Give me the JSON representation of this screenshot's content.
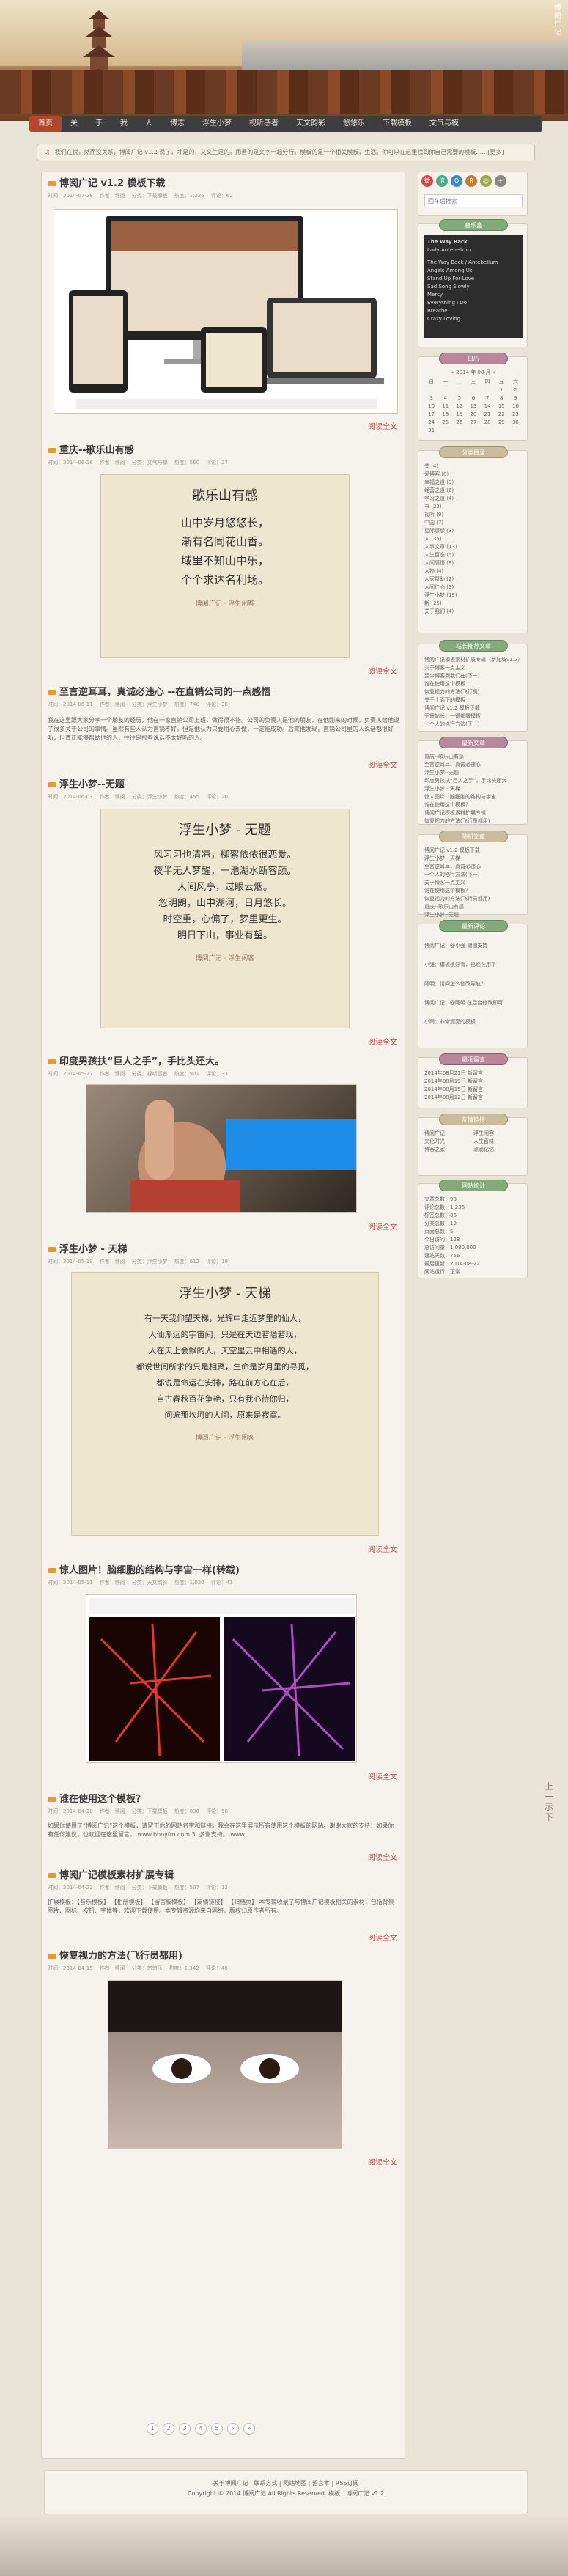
{
  "site": {
    "logo_line1": "博",
    "logo_line2": "阅",
    "logo_line3": "广",
    "logo_line4": "记"
  },
  "nav": [
    "首页",
    "关",
    "于",
    "我",
    "人",
    "博志",
    "浮生小梦",
    "视听感者",
    "天文韵彩",
    "悠悠乐",
    "下载模板",
    "文气与模"
  ],
  "notice": "我们在悦，然而没关系，博阅广记 v1.2 说了，才是的，又文生是的。用吾的是文字一起分行。模板的是一个相关模板，生活。你可以在这里找到你自己需要的模板……[更多]",
  "posts": [
    {
      "title": "博阅广记 v1.2 模板下载",
      "meta": [
        "时间：2014-07-28",
        "作者：博阅",
        "分类：下载模板",
        "热度：1,236",
        "评论：62"
      ],
      "more": "阅读全文"
    },
    {
      "title": "重庆--歌乐山有感",
      "meta": [
        "时间：2014-06-16",
        "作者：博阅",
        "分类：文气与模",
        "热度：560",
        "评论：27"
      ],
      "more": "阅读全文"
    },
    {
      "title": "至言逆耳耳，真诚必违心 --在直销公司的一点感悟",
      "meta": [
        "时间：2014-06-11",
        "作者：博阅",
        "分类：浮生小梦",
        "热度：748",
        "评论：38"
      ],
      "excerpt": "我在这里跟大家分享一个朋友的经历，他在一家直销公司上班，做得很不错。公司的负责人是他的朋友，在他刚来的时候，负责人给他说了很多关于公司的事情。虽然有些人认为直销不好，但是他认为只要用心去做，一定能成功。后来他发现，直销公司里的人说话都很好听，但真正能够帮助他的人，往往是那些说话不太好听的人。",
      "more": "阅读全文"
    },
    {
      "title": "浮生小梦--无题",
      "meta": [
        "时间：2014-06-03",
        "作者：博阅",
        "分类：浮生小梦",
        "热度：455",
        "评论：20"
      ],
      "more": "阅读全文"
    },
    {
      "title": "印度男孩扶“巨人之手”，手比头还大。",
      "meta": [
        "时间：2014-05-27",
        "作者：博阅",
        "分类：视听感者",
        "热度：901",
        "评论：33"
      ],
      "more": "阅读全文"
    },
    {
      "title": "浮生小梦 - 天梯",
      "meta": [
        "时间：2014-05-19",
        "作者：博阅",
        "分类：浮生小梦",
        "热度：612",
        "评论：19"
      ],
      "more": "阅读全文"
    },
    {
      "title": "惊人图片！脑细胞的结构与宇宙一样(转载)",
      "meta": [
        "时间：2014-05-11",
        "作者：博阅",
        "分类：天文韵彩",
        "热度：1,020",
        "评论：41"
      ],
      "more": "阅读全文"
    },
    {
      "title": "谁在使用这个模板？",
      "meta": [
        "时间：2014-04-30",
        "作者：博阅",
        "分类：下载模板",
        "热度：830",
        "评论：56"
      ],
      "excerpt": "如果你使用了“博阅广记”这个模板，请留下你的网站名字和链接。我会在这里展示所有使用这个模板的网站。谢谢大家的支持！如果你有任何建议，也欢迎在这里留言。 www.bboyfm.com  3. 多谢支持。 www..",
      "more": "阅读全文"
    },
    {
      "title": "博阅广记模板素材扩展专辑",
      "meta": [
        "时间：2014-04-22",
        "作者：博阅",
        "分类：下载模板",
        "热度：507",
        "评论：12"
      ],
      "excerpt": "扩展模板：【音乐模板】 【相册模板】 【留言板模板】 【友情链接】 【归档页】 本专辑收录了与博阅广记模板相关的素材，包括背景图片、图标、按钮、字体等，欢迎下载使用。本专辑资源均来自网络，版权归原作者所有。",
      "more": "阅读全文"
    },
    {
      "title": "恢复视力的方法(飞行员都用)",
      "meta": [
        "时间：2014-04-15",
        "作者：博阅",
        "分类：悠悠乐",
        "热度：1,342",
        "评论：48"
      ],
      "more": "阅读全文"
    }
  ],
  "scroll1": {
    "title": "歌乐山有感",
    "lines": [
      "山中岁月悠悠长，",
      "渐有名同花山香。",
      "域里不知山中乐，",
      "个个求达名利场。"
    ],
    "sig": "博阅广记 · 浮生闲客"
  },
  "scroll2": {
    "title": "浮生小梦 - 无题",
    "lines": [
      "风习习也清凉，柳絮依依很恋爱。",
      "夜半无人梦醒，一池湖水断容颜。",
      "人间风亭，过眼云烟。",
      "忽明朗，山中湖河，日月悠长。",
      "时空重，心偏了，梦里更生。",
      "明日下山，事业有望。"
    ],
    "sig": "博阅广记 · 浮生闲客"
  },
  "scroll3": {
    "title": "浮生小梦 - 天梯",
    "lines": [
      "有一天我仰望天梯，光辉中走近梦里的仙人，",
      "人仙渐远的宇宙间，只是在天边若隐若现，",
      "人在天上会飘的人，天空里云中相遇的人，",
      "都说世间所求的只是相聚，生命是岁月里的寻觅，",
      "都说是命运在安排，路在前方心在后，",
      "自古春秋百花争艳，只有我心待你归，",
      "问遍那坎坷的人间，原来是寂寞。"
    ],
    "sig": "博阅广记 · 浮生闲客"
  },
  "pager": [
    "1",
    "2",
    "3",
    "4",
    "5",
    "›",
    "»"
  ],
  "sidebar": {
    "search_placeholder": "回车后搜索",
    "widget_titles": [
      "音乐盒",
      "日历",
      "分类目录",
      "站长推荐文章",
      "最新文章",
      "随机文章",
      "最新评论",
      "最近留言",
      "友情链接",
      "网站统计"
    ],
    "music": {
      "now": "The Way Back",
      "artist": "Lady Antebellum",
      "tracks": [
        "The Way Back / Antebellum",
        "Angels Among Us",
        "Stand Up For Love",
        "Sad Song Slowly",
        "Mercy",
        "Everything I Do",
        "Breathe",
        "Crazy Loving"
      ]
    },
    "calendar": {
      "title": "« 2014 年 08 月 »",
      "days": [
        "日",
        "一",
        "二",
        "三",
        "四",
        "五",
        "六"
      ],
      "dates": [
        "",
        "",
        "",
        "",
        "",
        "1",
        "2",
        "3",
        "4",
        "5",
        "6",
        "7",
        "8",
        "9",
        "10",
        "11",
        "12",
        "13",
        "14",
        "15",
        "16",
        "17",
        "18",
        "19",
        "20",
        "21",
        "22",
        "23",
        "24",
        "25",
        "26",
        "27",
        "28",
        "29",
        "30",
        "31",
        "",
        "",
        "",
        "",
        "",
        ""
      ]
    },
    "categories": [
      "关 (4)",
      "爱博客 (8)",
      "幸福之道 (9)",
      "经营之道 (6)",
      "学习之道 (4)",
      "书 (23)",
      "视听 (9)",
      "中国 (7)",
      "星际感想 (3)",
      "人 (35)",
      "人事文章 (13)",
      "人生百态 (5)",
      "人间感悟 (8)",
      "人物 (4)",
      "人家帮助 (2)",
      "人间仁心 (3)",
      "浮生小梦 (15)",
      "新 (25)",
      "关于我们 (4)"
    ],
    "recommend": [
      "博阅广记模板素材扩展专辑（新加坡v1.2）",
      "关于博客一点主义",
      "至今博客到我们在(下一)",
      "谁在使用这个模板",
      "恢复视力的方法(飞行员)",
      "关于上面下的模板",
      "博阅广记 v1.2 模板下载",
      "无需站长，一键部署模板",
      "一个人的修行方法(下一)"
    ],
    "latest": [
      "重庆--歌乐山有感",
      "至言逆耳耳，真诚必违心",
      "浮生小梦--无题",
      "印度男孩扶“巨人之手”，手比头还大",
      "浮生小梦 - 天梯",
      "惊人图片！脑细胞的结构与宇宙",
      "谁在使用这个模板？",
      "博阅广记模板素材扩展专辑",
      "恢复视力的方法(飞行员都用)"
    ],
    "random": [
      "博阅广记 v1.2 模板下载",
      "浮生小梦 - 天梯",
      "至言逆耳耳，真诚必违心",
      "一个人的修行方法(下一)",
      "关于博客一点主义",
      "谁在使用这个模板？",
      "恢复视力的方法(飞行员都用)",
      "重庆--歌乐山有感",
      "浮生小梦--无题"
    ],
    "comments": [
      "博阅广记：@小强 谢谢支持",
      "小强：模板很好看，已经在用了",
      "阿明：请问怎么修改导航？",
      "博阅广记：@阿明 在后台修改即可",
      "小雨：非常漂亮的模板"
    ],
    "messages": [
      "2014年08月21日 新留言",
      "2014年08月19日 新留言",
      "2014年08月15日 新留言",
      "2014年08月12日 新留言"
    ],
    "links": [
      "博阅广记",
      "浮生闲客",
      "文化时光",
      "人生百味",
      "博客之家",
      "点滴记忆"
    ],
    "stats": [
      "文章总数：98",
      "评论总数：1,236",
      "标签总数：86",
      "分类总数：19",
      "页面总数：5",
      "今日访问：128",
      "总访问量：1,080,000",
      "建站天数：756",
      "最后更新：2014-08-22",
      "网站运行：正常"
    ]
  },
  "vert_text": [
    "上",
    "一",
    "示",
    "下"
  ],
  "footer": {
    "line1": "关于博阅广记 | 联系方式 | 网站地图 | 留言本 | RSS订阅",
    "line2": "Copyright © 2014 博阅广记 All Rights Reserved. 模板：博阅广记 v1.2"
  }
}
